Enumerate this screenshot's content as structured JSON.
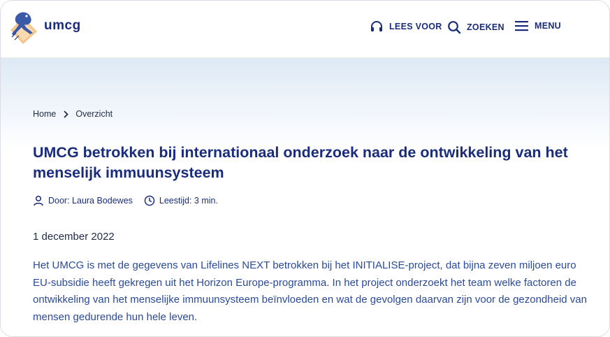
{
  "header": {
    "brand": "umcg",
    "nav": {
      "read_aloud": "LEES VOOR",
      "search": "ZOEKEN",
      "menu": "MENU"
    }
  },
  "breadcrumb": {
    "home": "Home",
    "current": "Overzicht"
  },
  "article": {
    "title": "UMCG betrokken bij internationaal onderzoek naar de ontwikkeling van het menselijk immuunsysteem",
    "author": "Door: Laura Bodewes",
    "reading_time": "Leestijd: 3 min.",
    "date": "1 december 2022",
    "lead": "Het UMCG is met de gegevens van Lifelines NEXT betrokken bij het INITIALISE-project, dat bijna zeven miljoen euro EU-subsidie heeft gekregen uit het Horizon Europe-programma. In het project onderzoekt het team welke factoren de ontwikkeling van het menselijke immuunsysteem beïnvloeden en wat de gevolgen daarvan zijn voor de gezondheid van mensen gedurende hun hele leven."
  },
  "colors": {
    "primary": "#1a2d7c",
    "link_text": "#2a4a9a",
    "logo_orange": "#f3b04a",
    "logo_blue": "#3a5aa8"
  },
  "icons": {
    "logo": "umcg-frog-logo",
    "read": "headphones-icon",
    "search": "search-icon",
    "menu": "hamburger-icon",
    "chevron": "chevron-right-icon",
    "author": "user-icon",
    "time": "clock-icon"
  }
}
